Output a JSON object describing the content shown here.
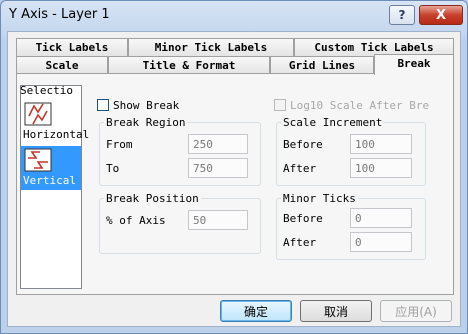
{
  "window": {
    "title": "Y Axis - Layer 1",
    "help_label": "?",
    "close_label": "X"
  },
  "tabs_row1": [
    "Tick Labels",
    "Minor Tick Labels",
    "Custom Tick Labels"
  ],
  "tabs_row2": [
    "Scale",
    "Title & Format",
    "Grid Lines",
    "Break"
  ],
  "active_tab": "Break",
  "selection": {
    "label": "Selectio",
    "items": [
      {
        "label": "Horizontal",
        "icon": "horizontal-break-icon",
        "selected": false
      },
      {
        "label": "Vertical",
        "icon": "vertical-break-icon",
        "selected": true
      }
    ]
  },
  "show_break": {
    "label": "Show Break",
    "checked": false
  },
  "log10": {
    "label": "Log10 Scale After Bre",
    "checked": false,
    "enabled": false
  },
  "break_region": {
    "title": "Break Region",
    "from_label": "From",
    "from_value": "250",
    "to_label": "To",
    "to_value": "750"
  },
  "scale_increment": {
    "title": "Scale Increment",
    "before_label": "Before",
    "before_value": "100",
    "after_label": "After",
    "after_value": "100"
  },
  "break_position": {
    "title": "Break Position",
    "axis_label": "% of Axis",
    "axis_value": "50"
  },
  "minor_ticks": {
    "title": "Minor Ticks",
    "before_label": "Before",
    "before_value": "0",
    "after_label": "After",
    "after_value": "0"
  },
  "buttons": {
    "ok": "确定",
    "cancel": "取消",
    "apply": "应用(A)"
  },
  "colors": {
    "selected_item": "#3399ff",
    "title_bar": "#bcd0ea",
    "close_button": "#c7412c"
  }
}
